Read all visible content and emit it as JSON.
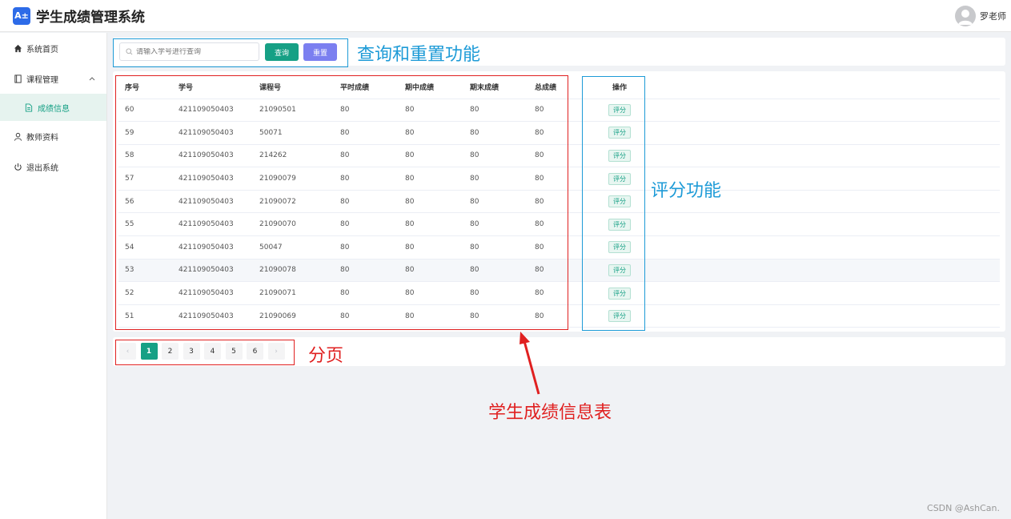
{
  "header": {
    "logo_text": "A±",
    "title": "学生成绩管理系统",
    "user_name": "罗老师"
  },
  "sidebar": {
    "items": [
      {
        "label": "系统首页",
        "icon": "home-icon"
      },
      {
        "label": "课程管理",
        "icon": "book-icon"
      },
      {
        "label": "成绩信息",
        "icon": "document-icon"
      },
      {
        "label": "教师资料",
        "icon": "user-icon"
      },
      {
        "label": "退出系统",
        "icon": "power-icon"
      }
    ]
  },
  "search": {
    "placeholder": "请输入学号进行查询",
    "query_label": "查询",
    "reset_label": "重置"
  },
  "table": {
    "headers": [
      "序号",
      "学号",
      "课程号",
      "平时成绩",
      "期中成绩",
      "期末成绩",
      "总成绩",
      "操作"
    ],
    "action_label": "评分",
    "rows": [
      [
        "60",
        "421109050403",
        "21090501",
        "80",
        "80",
        "80",
        "80"
      ],
      [
        "59",
        "421109050403",
        "50071",
        "80",
        "80",
        "80",
        "80"
      ],
      [
        "58",
        "421109050403",
        "214262",
        "80",
        "80",
        "80",
        "80"
      ],
      [
        "57",
        "421109050403",
        "21090079",
        "80",
        "80",
        "80",
        "80"
      ],
      [
        "56",
        "421109050403",
        "21090072",
        "80",
        "80",
        "80",
        "80"
      ],
      [
        "55",
        "421109050403",
        "21090070",
        "80",
        "80",
        "80",
        "80"
      ],
      [
        "54",
        "421109050403",
        "50047",
        "80",
        "80",
        "80",
        "80"
      ],
      [
        "53",
        "421109050403",
        "21090078",
        "80",
        "80",
        "80",
        "80"
      ],
      [
        "52",
        "421109050403",
        "21090071",
        "80",
        "80",
        "80",
        "80"
      ],
      [
        "51",
        "421109050403",
        "21090069",
        "80",
        "80",
        "80",
        "80"
      ]
    ]
  },
  "pagination": {
    "prev": "‹",
    "next": "›",
    "pages": [
      "1",
      "2",
      "3",
      "4",
      "5",
      "6"
    ],
    "current": "1"
  },
  "annotations": {
    "search": "查询和重置功能",
    "rating": "评分功能",
    "pagination": "分页",
    "table": "学生成绩信息表"
  },
  "colors": {
    "primary": "#16a085",
    "reset": "#7b7ff0",
    "annotation_blue": "#1e9bd7",
    "annotation_red": "#e02020"
  },
  "watermark": "CSDN @AshCan."
}
